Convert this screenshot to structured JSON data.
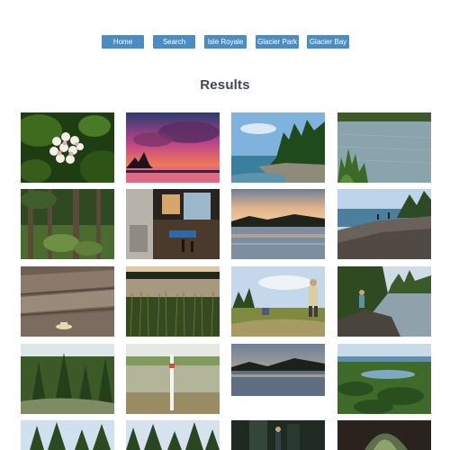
{
  "nav": {
    "items": [
      {
        "label": "Home"
      },
      {
        "label": "Search"
      },
      {
        "label": "Isle Royale"
      },
      {
        "label": "Glacier Park"
      },
      {
        "label": "Glacier Bay"
      }
    ]
  },
  "results": {
    "title": "Results"
  }
}
